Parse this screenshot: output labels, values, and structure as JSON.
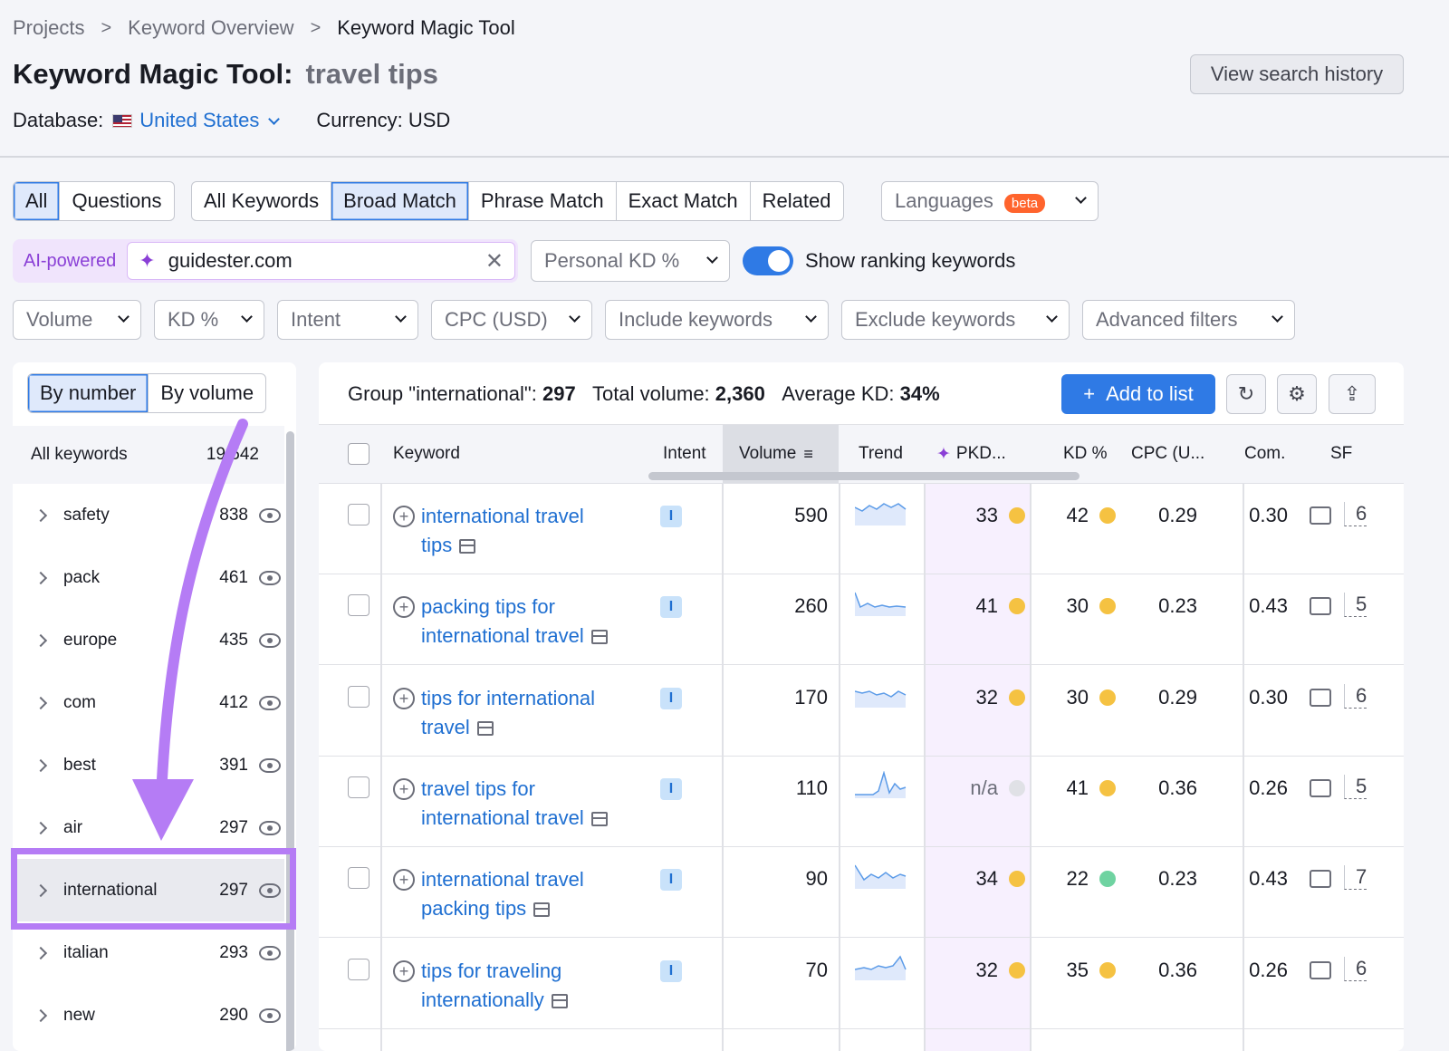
{
  "breadcrumb": [
    "Projects",
    "Keyword Overview",
    "Keyword Magic Tool"
  ],
  "title": {
    "prefix": "Keyword Magic Tool:",
    "keyword": "travel tips"
  },
  "database": {
    "label": "Database:",
    "value": "United States"
  },
  "currency": "Currency: USD",
  "view_history": "View search history",
  "tabs_group1": [
    "All",
    "Questions"
  ],
  "tabs_group2": [
    "All Keywords",
    "Broad Match",
    "Phrase Match",
    "Exact Match",
    "Related"
  ],
  "languages": {
    "label": "Languages",
    "badge": "beta"
  },
  "ai": {
    "label": "AI-powered",
    "domain": "guidester.com"
  },
  "personal_kd": "Personal KD %",
  "show_ranking": "Show ranking keywords",
  "filters": [
    "Volume",
    "KD %",
    "Intent",
    "CPC (USD)",
    "Include keywords",
    "Exclude keywords",
    "Advanced filters"
  ],
  "sidebar": {
    "by_number": "By number",
    "by_volume": "By volume",
    "all_label": "All keywords",
    "all_count": "19,542",
    "groups": [
      {
        "name": "safety",
        "count": "838"
      },
      {
        "name": "pack",
        "count": "461"
      },
      {
        "name": "europe",
        "count": "435"
      },
      {
        "name": "com",
        "count": "412"
      },
      {
        "name": "best",
        "count": "391"
      },
      {
        "name": "air",
        "count": "297"
      },
      {
        "name": "international",
        "count": "297"
      },
      {
        "name": "italian",
        "count": "293"
      },
      {
        "name": "new",
        "count": "290"
      }
    ]
  },
  "summary": {
    "group_label": "Group \"international\":",
    "group_count": "297",
    "volume_label": "Total volume:",
    "volume": "2,360",
    "kd_label": "Average KD:",
    "kd": "34%"
  },
  "add_to_list": "Add to list",
  "columns": {
    "keyword": "Keyword",
    "intent": "Intent",
    "volume": "Volume",
    "trend": "Trend",
    "pkd": "PKD...",
    "kd": "KD %",
    "cpc": "CPC (U...",
    "com": "Com.",
    "sf": "SF"
  },
  "rows": [
    {
      "kw1": "international travel",
      "kw2": "tips",
      "intent": "I",
      "volume": "590",
      "pkd": "33",
      "kd": "42",
      "cpc": "0.29",
      "com": "0.30",
      "sf": "6",
      "pkd_color": "#f5c242",
      "kd_color": "#f5c242"
    },
    {
      "kw1": "packing tips for",
      "kw2": "international travel",
      "intent": "I",
      "volume": "260",
      "pkd": "41",
      "kd": "30",
      "cpc": "0.23",
      "com": "0.43",
      "sf": "5",
      "pkd_color": "#f5c242",
      "kd_color": "#f5c242"
    },
    {
      "kw1": "tips for international",
      "kw2": "travel",
      "intent": "I",
      "volume": "170",
      "pkd": "32",
      "kd": "30",
      "cpc": "0.29",
      "com": "0.30",
      "sf": "6",
      "pkd_color": "#f5c242",
      "kd_color": "#f5c242"
    },
    {
      "kw1": "travel tips for",
      "kw2": "international travel",
      "intent": "I",
      "volume": "110",
      "pkd": "n/a",
      "kd": "41",
      "cpc": "0.36",
      "com": "0.26",
      "sf": "5",
      "pkd_color": "#e0e1e6",
      "kd_color": "#f5c242"
    },
    {
      "kw1": "international travel",
      "kw2": "packing tips",
      "intent": "I",
      "volume": "90",
      "pkd": "34",
      "kd": "22",
      "cpc": "0.23",
      "com": "0.43",
      "sf": "7",
      "pkd_color": "#f5c242",
      "kd_color": "#6fd3a1"
    },
    {
      "kw1": "tips for traveling",
      "kw2": "internationally",
      "intent": "I",
      "volume": "70",
      "pkd": "32",
      "kd": "35",
      "cpc": "0.36",
      "com": "0.26",
      "sf": "6",
      "pkd_color": "#f5c242",
      "kd_color": "#f5c242"
    }
  ],
  "colors": {
    "accent": "#2f7ae5",
    "highlight": "#b57cf5",
    "ai": "#8a3fd6"
  }
}
